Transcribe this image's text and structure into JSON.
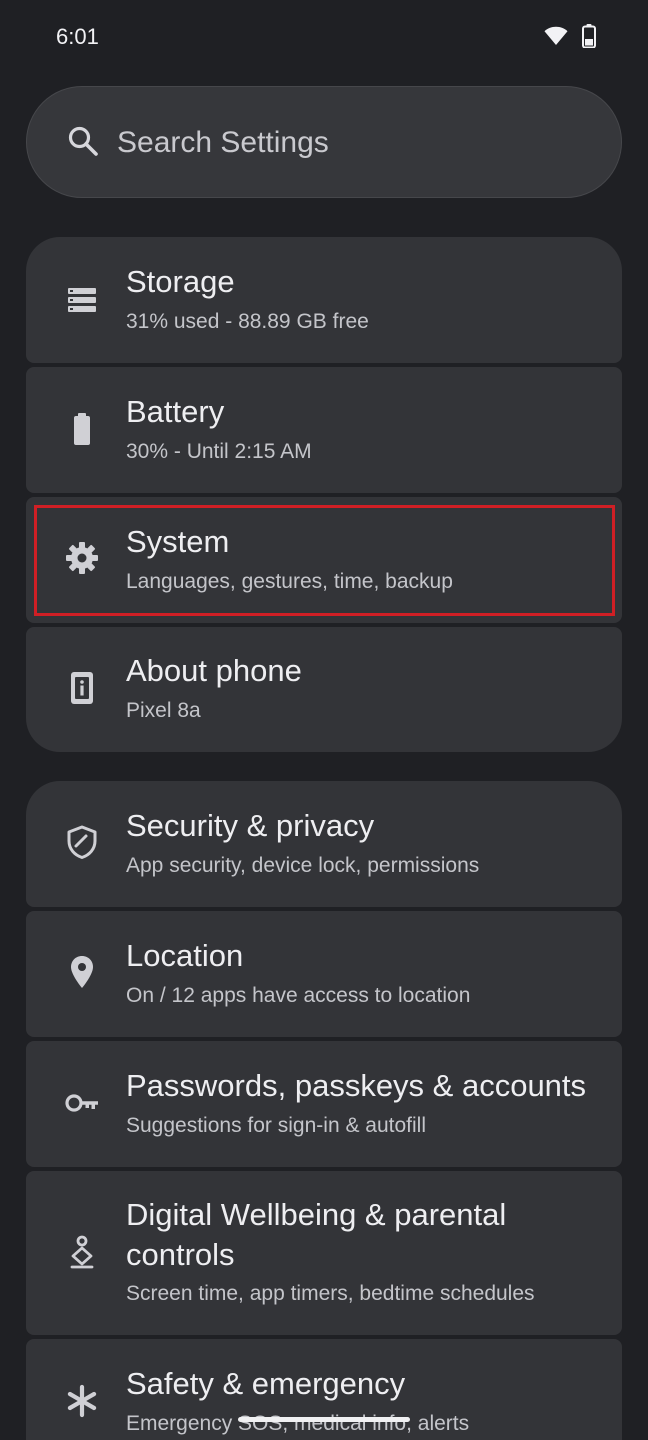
{
  "status_bar": {
    "time": "6:01",
    "icons": [
      "wifi-icon",
      "battery-icon"
    ]
  },
  "search": {
    "placeholder": "Search Settings",
    "value": ""
  },
  "settings_items": [
    {
      "id": "storage",
      "icon": "storage-icon",
      "title": "Storage",
      "subtitle": "31% used - 88.89 GB free"
    },
    {
      "id": "battery",
      "icon": "battery-icon",
      "title": "Battery",
      "subtitle": "30% - Until 2:15 AM"
    },
    {
      "id": "system",
      "icon": "gear-icon",
      "title": "System",
      "subtitle": "Languages, gestures, time, backup",
      "highlighted": true
    },
    {
      "id": "about-phone",
      "icon": "phone-info-icon",
      "title": "About phone",
      "subtitle": "Pixel 8a"
    },
    {
      "id": "security-privacy",
      "icon": "shield-icon",
      "title": "Security & privacy",
      "subtitle": "App security, device lock, permissions"
    },
    {
      "id": "location",
      "icon": "location-pin-icon",
      "title": "Location",
      "subtitle": "On / 12 apps have access to location"
    },
    {
      "id": "passwords-accounts",
      "icon": "key-icon",
      "title": "Passwords, passkeys & accounts",
      "subtitle": "Suggestions for sign-in & autofill"
    },
    {
      "id": "digital-wellbeing",
      "icon": "wellbeing-icon",
      "title": "Digital Wellbeing & parental controls",
      "subtitle": "Screen time, app timers, bedtime schedules"
    },
    {
      "id": "safety-emergency",
      "icon": "asterisk-icon",
      "title": "Safety & emergency",
      "subtitle": "Emergency SOS, medical info, alerts"
    }
  ],
  "colors": {
    "background": "#1f2024",
    "card": "#333438",
    "highlight": "#d01f25"
  }
}
